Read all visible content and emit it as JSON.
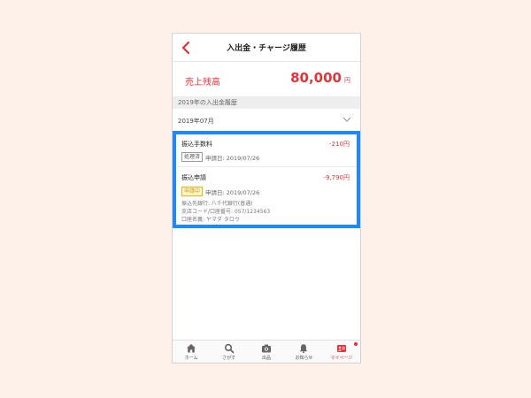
{
  "header": {
    "title": "入出金・チャージ履歴",
    "back_icon": "chevron-left-icon"
  },
  "balance": {
    "label": "売上残高",
    "amount": "80,000",
    "unit": "円"
  },
  "history": {
    "section_title": "2019年の入出金履歴",
    "selected_month": "2019年07月"
  },
  "entries": [
    {
      "title": "振込手数料",
      "amount": "-210円",
      "status": "処理済",
      "date": "申請日: 2019/07/26"
    },
    {
      "title": "振込申請",
      "amount": "-9,790円",
      "status": "申請中",
      "date": "申請日: 2019/07/26",
      "bank": "振込先銀行: 八千代銀行(普通)",
      "account": "支店コード/口座番号: 057/1234563",
      "holder": "口座名義: ヤマダ タロウ"
    }
  ],
  "tabs": [
    {
      "label": "ホーム",
      "icon": "home-icon"
    },
    {
      "label": "さがす",
      "icon": "search-icon"
    },
    {
      "label": "出品",
      "icon": "camera-icon"
    },
    {
      "label": "お知らせ",
      "icon": "bell-icon"
    },
    {
      "label": "マイページ",
      "icon": "profile-card-icon",
      "active": true
    }
  ],
  "colors": {
    "accent": "#e5333a",
    "highlight": "#1e88ff",
    "background": "#fdf1ea"
  }
}
